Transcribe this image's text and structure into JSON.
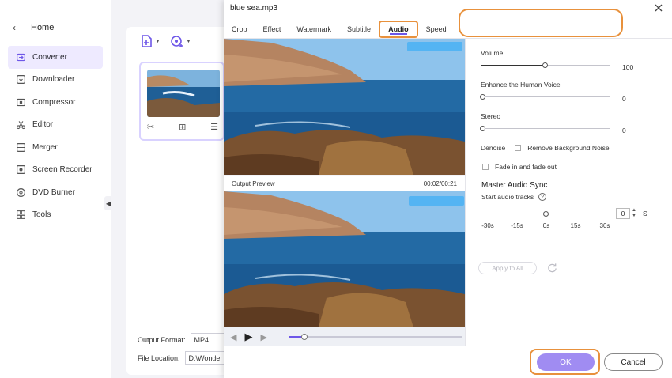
{
  "sidebar": {
    "home_label": "Home",
    "items": [
      {
        "label": "Converter",
        "icon": "converter-icon",
        "active": true
      },
      {
        "label": "Downloader",
        "icon": "downloader-icon",
        "active": false
      },
      {
        "label": "Compressor",
        "icon": "compressor-icon",
        "active": false
      },
      {
        "label": "Editor",
        "icon": "scissors-icon",
        "active": false
      },
      {
        "label": "Merger",
        "icon": "merger-icon",
        "active": false
      },
      {
        "label": "Screen Recorder",
        "icon": "screen-recorder-icon",
        "active": false
      },
      {
        "label": "DVD Burner",
        "icon": "dvd-icon",
        "active": false
      },
      {
        "label": "Tools",
        "icon": "tools-icon",
        "active": false
      }
    ]
  },
  "workspace": {
    "output_format_label": "Output Format:",
    "output_format_value": "MP4",
    "file_location_label": "File Location:",
    "file_location_value": "D:\\Wonder"
  },
  "dialog": {
    "title": "blue sea.mp3",
    "tabs": [
      {
        "label": "Crop",
        "active": false
      },
      {
        "label": "Effect",
        "active": false
      },
      {
        "label": "Watermark",
        "active": false
      },
      {
        "label": "Subtitle",
        "active": false
      },
      {
        "label": "Audio",
        "active": true
      },
      {
        "label": "Speed",
        "active": false
      }
    ],
    "output_preview_label": "Output Preview",
    "time_readout": "00:02/00:21",
    "seek_progress": 0.09,
    "audio": {
      "volume_label": "Volume",
      "volume_value": "100",
      "volume_fraction": 0.5,
      "enhance_label": "Enhance the Human Voice",
      "enhance_value": "0",
      "stereo_label": "Stereo",
      "stereo_value": "0",
      "denoise_label": "Denoise",
      "remove_noise_label": "Remove Background Noise",
      "fade_label": "Fade in and fade out",
      "master_sync_title": "Master Audio Sync",
      "start_tracks_label": "Start audio tracks",
      "sync_value": "0",
      "sync_unit": "S",
      "sync_ticks": [
        "-30s",
        "-15s",
        "0s",
        "15s",
        "30s"
      ],
      "apply_all_label": "Apply to All"
    },
    "ok_label": "OK",
    "cancel_label": "Cancel"
  },
  "colors": {
    "accent": "#6e57e8",
    "highlight": "#e8913c",
    "ok_button": "#a08cf2"
  }
}
